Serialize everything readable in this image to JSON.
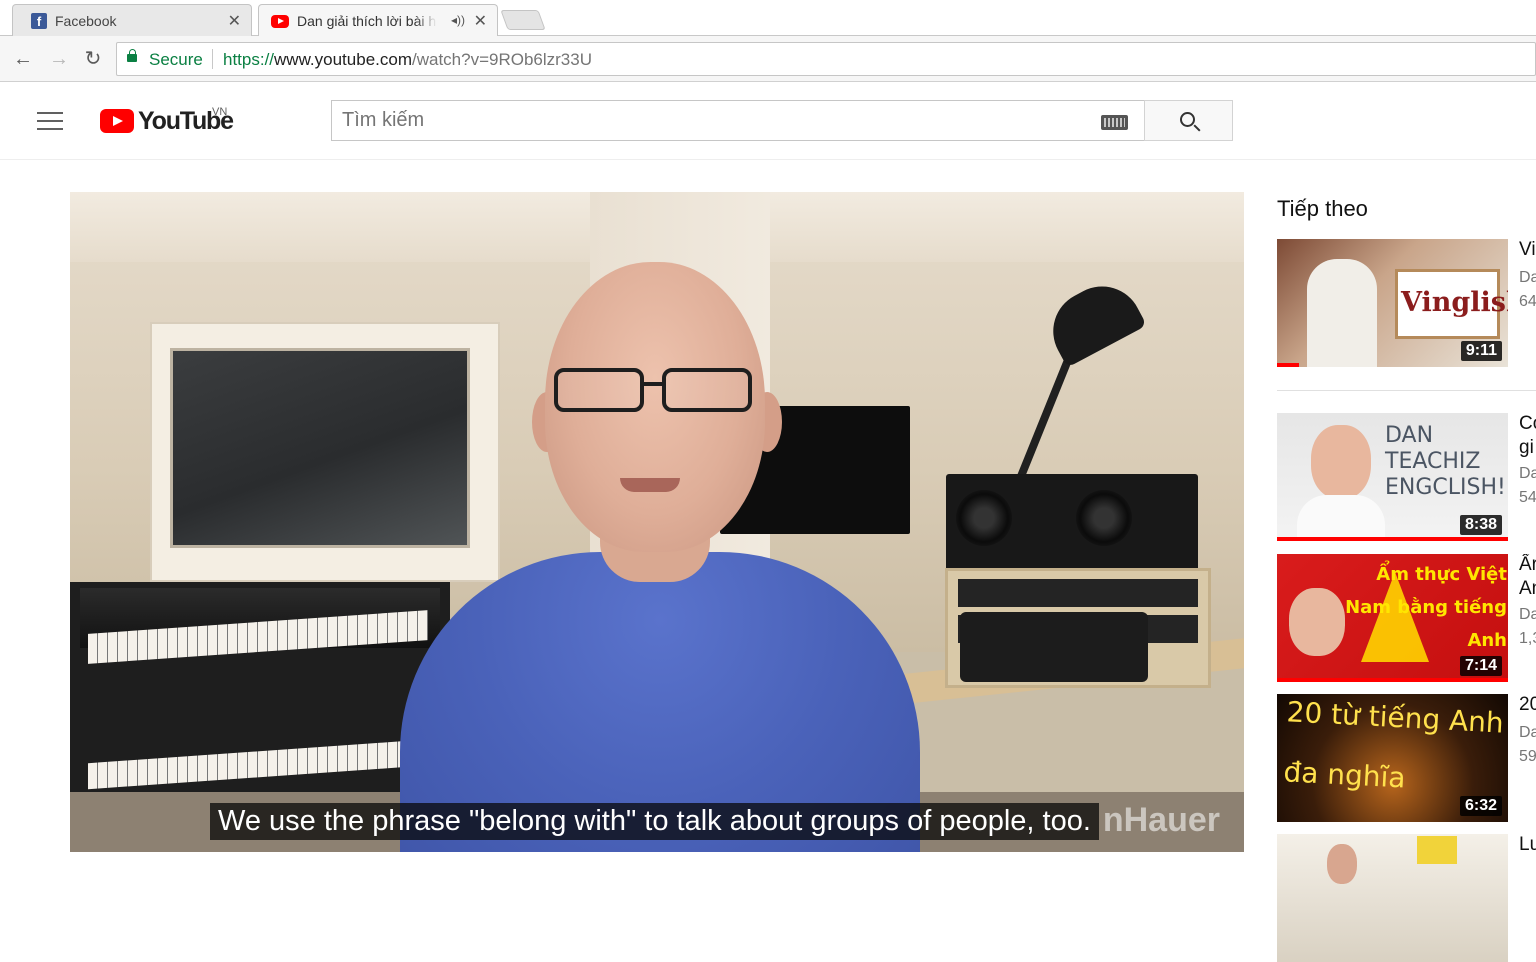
{
  "browser": {
    "tabs": [
      {
        "title": "Facebook",
        "active": false
      },
      {
        "title": "Dan giải thích lời bài h",
        "active": true,
        "audio": true
      }
    ],
    "secure_label": "Secure",
    "url": {
      "scheme": "https://",
      "host": "www.youtube.com",
      "path": "/watch?v=9ROb6lzr33U"
    }
  },
  "youtube": {
    "logo_text": "YouTube",
    "country_code": "VN",
    "search_placeholder": "Tìm kiếm"
  },
  "player": {
    "caption": "We use the phrase \"belong with\" to talk about groups of people, too.",
    "watermark": "nHauer"
  },
  "sidebar": {
    "heading": "Tiếp theo",
    "items": [
      {
        "title": "Vi",
        "channel": "Da",
        "views": "64",
        "duration": "9:11",
        "thumb_text": "Vinglish"
      },
      {
        "title": "Co",
        "title2": "gi",
        "channel": "Da",
        "views": "54",
        "duration": "8:38",
        "thumb_text": "DAN TEACHIZ ENGCLISH!"
      },
      {
        "title": "Ẩr",
        "title2": "An",
        "channel": "Da",
        "views": "1,3",
        "duration": "7:14",
        "thumb_text": "Ẩm thực Việt Nam bằng tiếng Anh"
      },
      {
        "title": "20",
        "channel": "Da",
        "views": "59",
        "duration": "6:32",
        "thumb_text": "20 từ tiếng Anh đa nghĩa"
      },
      {
        "title": "Lu"
      }
    ]
  },
  "colors": {
    "youtube_red": "#ff0000",
    "secure_green": "#0b8043",
    "shirt_blue": "#4a62b9"
  }
}
